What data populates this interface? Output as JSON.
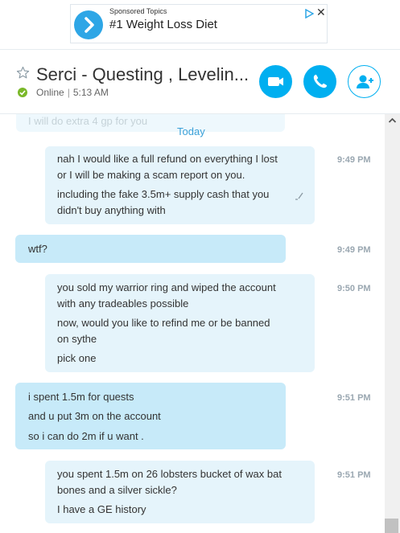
{
  "ad": {
    "sponsored": "Sponsored Topics",
    "title": "#1 Weight Loss Diet",
    "close": "✕"
  },
  "header": {
    "title": "Serci - Questing , Levelin...",
    "status": "Online",
    "time": "5:13 AM"
  },
  "conversation": {
    "faded_prev": "I will do extra 4 gp for you",
    "date_divider": "Today",
    "messages": [
      {
        "direction": "out",
        "time": "9:49 PM",
        "lines": [
          "nah I would like a full refund on everything I lost",
          "or I will be making a scam report on you.",
          "including the fake 3.5m+ supply cash that you",
          "didn't buy anything with"
        ],
        "edited": true
      },
      {
        "direction": "in",
        "time": "9:49 PM",
        "lines": [
          "wtf?"
        ]
      },
      {
        "direction": "out",
        "time": "9:50 PM",
        "lines": [
          "you sold my warrior ring and wiped the account",
          "with any tradeables possible",
          "now, would you like to refind me or be banned",
          "on sythe",
          "pick one"
        ]
      },
      {
        "direction": "in",
        "time": "9:51 PM",
        "lines": [
          "i spent 1.5m for quests",
          "and u put 3m on the account",
          "so i can do 2m if u want ."
        ]
      },
      {
        "direction": "out",
        "time": "9:51 PM",
        "lines": [
          "you spent 1.5m on 26 lobsters bucket of wax bat",
          "bones and a silver sickle?",
          "I have a GE history"
        ]
      }
    ]
  },
  "colors": {
    "accent": "#00aff0",
    "online": "#7ab829",
    "bubble_out": "#e5f4fb",
    "bubble_in": "#c7eaf9"
  }
}
